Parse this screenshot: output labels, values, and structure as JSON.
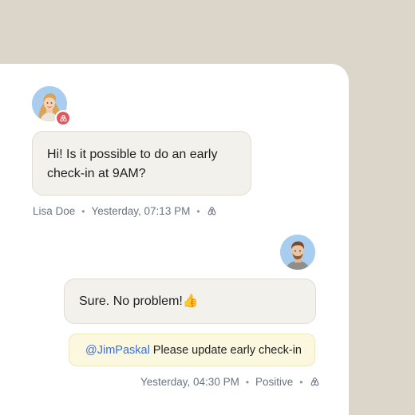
{
  "conversation": {
    "incoming": {
      "message": "Hi! Is it possible to do an early check-in at 9AM?",
      "sender": "Lisa Doe",
      "timestamp": "Yesterday, 07:13 PM",
      "channel_icon": "airbnb-icon",
      "avatar_icon": "woman-avatar"
    },
    "outgoing": {
      "message": "Sure. No problem!👍",
      "timestamp": "Yesterday, 04:30 PM",
      "sentiment": "Positive",
      "channel_icon": "airbnb-icon",
      "avatar_icon": "man-avatar"
    },
    "internal_note": {
      "mention": "@JimPaskal",
      "text": "Please update early check-in"
    },
    "separator": "•"
  },
  "colors": {
    "background": "#dcd5ca",
    "card": "#ffffff",
    "bubble": "#f3f1ec",
    "note": "#fbf8df",
    "mention": "#3d6fd0",
    "airbnb_badge": "#e0565b"
  }
}
